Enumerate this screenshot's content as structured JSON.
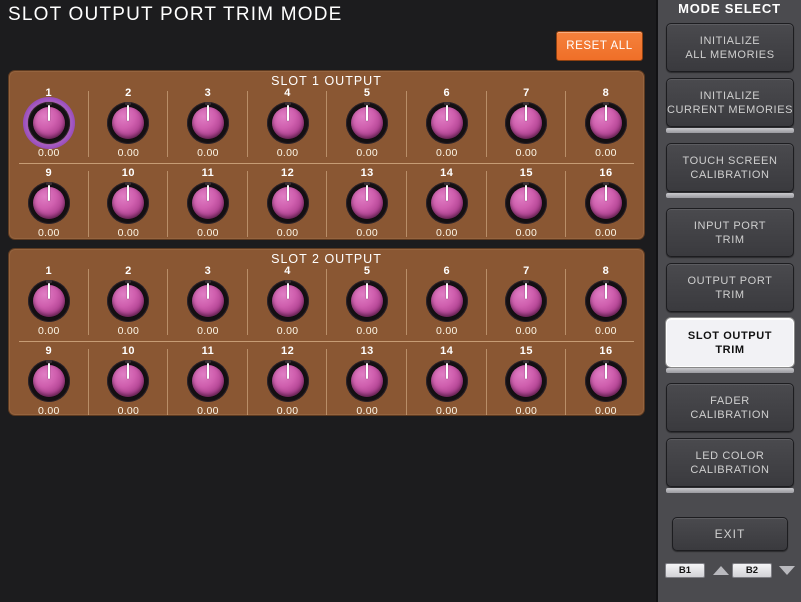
{
  "page": {
    "title": "SLOT OUTPUT PORT TRIM MODE",
    "background_color": "#1c1c1e"
  },
  "toolbar": {
    "reset_all_label": "RESET ALL",
    "reset_all_color": "#ef6f28"
  },
  "panels": [
    {
      "header": "SLOT 1 OUTPUT",
      "panel_color": "#8a5733",
      "knobs": [
        {
          "index": "1",
          "value": "0.00",
          "selected": true
        },
        {
          "index": "2",
          "value": "0.00",
          "selected": false
        },
        {
          "index": "3",
          "value": "0.00",
          "selected": false
        },
        {
          "index": "4",
          "value": "0.00",
          "selected": false
        },
        {
          "index": "5",
          "value": "0.00",
          "selected": false
        },
        {
          "index": "6",
          "value": "0.00",
          "selected": false
        },
        {
          "index": "7",
          "value": "0.00",
          "selected": false
        },
        {
          "index": "8",
          "value": "0.00",
          "selected": false
        },
        {
          "index": "9",
          "value": "0.00",
          "selected": false
        },
        {
          "index": "10",
          "value": "0.00",
          "selected": false
        },
        {
          "index": "11",
          "value": "0.00",
          "selected": false
        },
        {
          "index": "12",
          "value": "0.00",
          "selected": false
        },
        {
          "index": "13",
          "value": "0.00",
          "selected": false
        },
        {
          "index": "14",
          "value": "0.00",
          "selected": false
        },
        {
          "index": "15",
          "value": "0.00",
          "selected": false
        },
        {
          "index": "16",
          "value": "0.00",
          "selected": false
        }
      ]
    },
    {
      "header": "SLOT 2 OUTPUT",
      "panel_color": "#8a5733",
      "knobs": [
        {
          "index": "1",
          "value": "0.00",
          "selected": false
        },
        {
          "index": "2",
          "value": "0.00",
          "selected": false
        },
        {
          "index": "3",
          "value": "0.00",
          "selected": false
        },
        {
          "index": "4",
          "value": "0.00",
          "selected": false
        },
        {
          "index": "5",
          "value": "0.00",
          "selected": false
        },
        {
          "index": "6",
          "value": "0.00",
          "selected": false
        },
        {
          "index": "7",
          "value": "0.00",
          "selected": false
        },
        {
          "index": "8",
          "value": "0.00",
          "selected": false
        },
        {
          "index": "9",
          "value": "0.00",
          "selected": false
        },
        {
          "index": "10",
          "value": "0.00",
          "selected": false
        },
        {
          "index": "11",
          "value": "0.00",
          "selected": false
        },
        {
          "index": "12",
          "value": "0.00",
          "selected": false
        },
        {
          "index": "13",
          "value": "0.00",
          "selected": false
        },
        {
          "index": "14",
          "value": "0.00",
          "selected": false
        },
        {
          "index": "15",
          "value": "0.00",
          "selected": false
        },
        {
          "index": "16",
          "value": "0.00",
          "selected": false
        }
      ]
    }
  ],
  "sidebar": {
    "title": "MODE SELECT",
    "items": [
      {
        "name": "initialize-all-memories",
        "lines": [
          "INITIALIZE",
          "ALL MEMORIES"
        ],
        "selected": false,
        "sep_after": false
      },
      {
        "name": "initialize-current-memories",
        "lines": [
          "INITIALIZE",
          "CURRENT MEMORIES"
        ],
        "selected": false,
        "sep_after": true
      },
      {
        "name": "touch-screen-calibration",
        "lines": [
          "TOUCH SCREEN",
          "CALIBRATION"
        ],
        "selected": false,
        "sep_after": true
      },
      {
        "name": "input-port-trim",
        "lines": [
          "INPUT PORT",
          "TRIM"
        ],
        "selected": false,
        "sep_after": false
      },
      {
        "name": "output-port-trim",
        "lines": [
          "OUTPUT PORT",
          "TRIM"
        ],
        "selected": false,
        "sep_after": false
      },
      {
        "name": "slot-output-trim",
        "lines": [
          "SLOT OUTPUT",
          "TRIM"
        ],
        "selected": true,
        "sep_after": true
      },
      {
        "name": "fader-calibration",
        "lines": [
          "FADER",
          "CALIBRATION"
        ],
        "selected": false,
        "sep_after": false
      },
      {
        "name": "led-color-calibration",
        "lines": [
          "LED COLOR",
          "CALIBRATION"
        ],
        "selected": false,
        "sep_after": true
      }
    ],
    "exit_label": "EXIT",
    "bank_b1_label": "B1",
    "bank_b2_label": "B2",
    "arrow_up_icon": "triangle-up-icon",
    "arrow_down_icon": "triangle-down-icon"
  }
}
